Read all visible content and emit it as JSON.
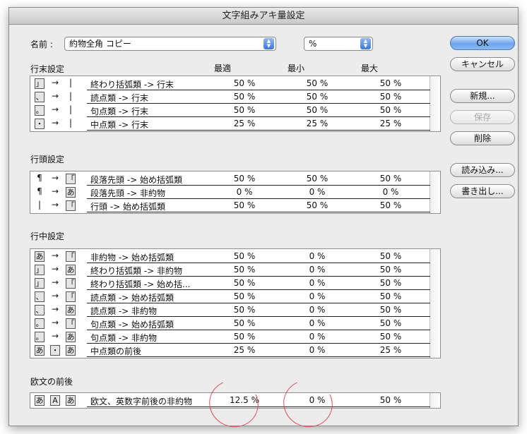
{
  "window": {
    "title": "文字組みアキ量設定"
  },
  "name_row": {
    "label": "名前 :",
    "name_value": "約物全角 コピー",
    "unit_value": "%"
  },
  "buttons": {
    "ok": "OK",
    "cancel": "キャンセル",
    "new": "新規...",
    "save": "保存",
    "delete": "削除",
    "load": "読み込み...",
    "export": "書き出し..."
  },
  "columns": {
    "opt": "最適",
    "min": "最小",
    "max": "最大"
  },
  "sections": [
    {
      "title": "行末設定",
      "rows": [
        {
          "g": [
            "」",
            "→",
            "|"
          ],
          "desc": "終わり括弧類 -> 行末",
          "opt": "50 %",
          "min": "50 %",
          "max": "50 %"
        },
        {
          "g": [
            "、",
            "→",
            "|"
          ],
          "desc": "読点類 -> 行末",
          "opt": "50 %",
          "min": "50 %",
          "max": "50 %"
        },
        {
          "g": [
            "。",
            "→",
            "|"
          ],
          "desc": "句点類 -> 行末",
          "opt": "50 %",
          "min": "50 %",
          "max": "50 %"
        },
        {
          "g": [
            "・",
            "→",
            "|"
          ],
          "desc": "中点類 -> 行末",
          "opt": "25 %",
          "min": "25 %",
          "max": "25 %"
        }
      ]
    },
    {
      "title": "行頭設定",
      "rows": [
        {
          "g": [
            "¶",
            "→",
            "「"
          ],
          "desc": "段落先頭 -> 始め括弧類",
          "opt": "50 %",
          "min": "50 %",
          "max": "50 %"
        },
        {
          "g": [
            "¶",
            "→",
            "あ"
          ],
          "desc": "段落先頭 -> 非約物",
          "opt": "0 %",
          "min": "0 %",
          "max": "0 %"
        },
        {
          "g": [
            "|",
            "→",
            "「"
          ],
          "desc": "行頭 -> 始め括弧類",
          "opt": "50 %",
          "min": "50 %",
          "max": "50 %"
        }
      ]
    },
    {
      "title": "行中設定",
      "rows": [
        {
          "g": [
            "あ",
            "→",
            "「"
          ],
          "desc": "非約物 -> 始め括弧類",
          "opt": "50 %",
          "min": "0 %",
          "max": "50 %"
        },
        {
          "g": [
            "」",
            "→",
            "あ"
          ],
          "desc": "終わり括弧類 -> 非約物",
          "opt": "50 %",
          "min": "0 %",
          "max": "50 %"
        },
        {
          "g": [
            "」",
            "→",
            "「"
          ],
          "desc": "終わり括弧類 -> 始め括...",
          "opt": "50 %",
          "min": "0 %",
          "max": "50 %"
        },
        {
          "g": [
            "、",
            "→",
            "「"
          ],
          "desc": "読点類 -> 始め括弧類",
          "opt": "50 %",
          "min": "0 %",
          "max": "50 %"
        },
        {
          "g": [
            "、",
            "→",
            "あ"
          ],
          "desc": "読点類 -> 非約物",
          "opt": "50 %",
          "min": "0 %",
          "max": "50 %"
        },
        {
          "g": [
            "。",
            "→",
            "「"
          ],
          "desc": "句点類 -> 始め括弧類",
          "opt": "50 %",
          "min": "0 %",
          "max": "50 %"
        },
        {
          "g": [
            "。",
            "→",
            "あ"
          ],
          "desc": "句点類 -> 非約物",
          "opt": "50 %",
          "min": "0 %",
          "max": "50 %"
        },
        {
          "g": [
            "あ",
            "・",
            "あ"
          ],
          "desc": "中点類の前後",
          "opt": "25 %",
          "min": "0 %",
          "max": "25 %"
        }
      ]
    },
    {
      "title": "欧文の前後",
      "rows": [
        {
          "g": [
            "あ",
            "A",
            "あ"
          ],
          "desc": "欧文、英数字前後の非約物",
          "opt": "12.5 %",
          "min": "0 %",
          "max": "50 %"
        }
      ]
    }
  ],
  "colors": {
    "highlight_circle": "#e34a55",
    "primary_button": "#6fa4ec"
  }
}
